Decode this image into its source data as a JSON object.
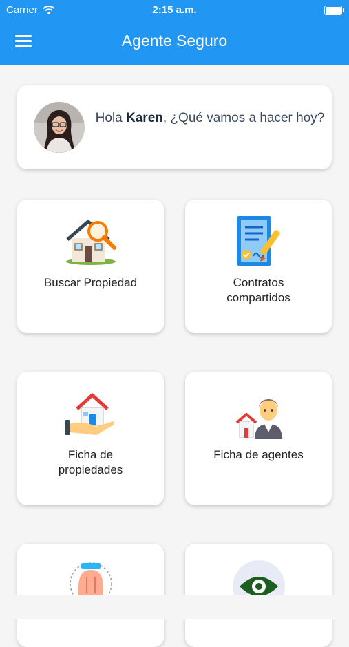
{
  "status_bar": {
    "carrier": "Carrier",
    "time": "2:15 a.m."
  },
  "header": {
    "title": "Agente Seguro"
  },
  "greeting": {
    "hello": "Hola ",
    "name": "Karen",
    "question": ", ¿Qué vamos a hacer hoy?"
  },
  "tiles": [
    {
      "label": "Buscar Propiedad",
      "icon": "house-search-icon"
    },
    {
      "label": "Contratos compartidos",
      "icon": "contract-sign-icon"
    },
    {
      "label": "Ficha de propiedades",
      "icon": "house-in-hand-icon"
    },
    {
      "label": "Ficha de agentes",
      "icon": "agent-icon"
    },
    {
      "label": "",
      "icon": "hand-icon"
    },
    {
      "label": "",
      "icon": "eye-icon"
    }
  ],
  "colors": {
    "primary": "#2196f3",
    "background": "#f5f5f5",
    "card": "#ffffff"
  }
}
